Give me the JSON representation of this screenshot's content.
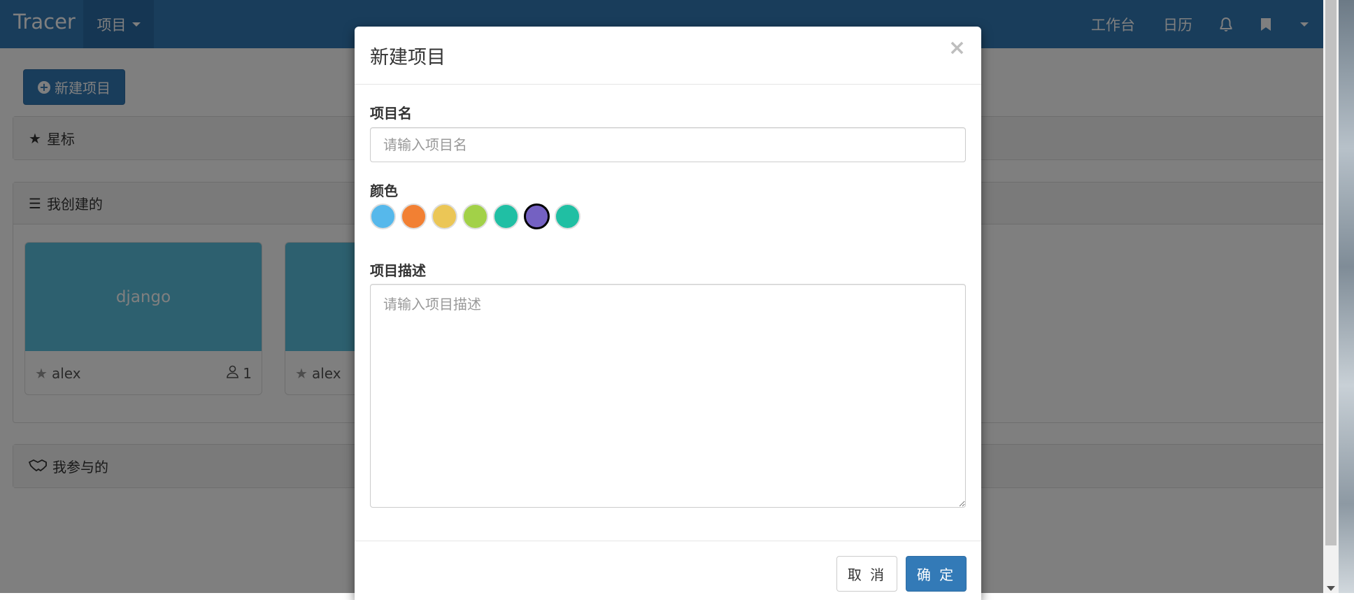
{
  "navbar": {
    "brand": "Tracer",
    "project_menu": "项目",
    "workbench": "工作台",
    "calendar": "日历"
  },
  "toolbar": {
    "new_project": "新建项目"
  },
  "panels": {
    "starred": "星标",
    "created": "我创建的",
    "joined": "我参与的"
  },
  "cards": [
    {
      "name": "django",
      "owner": "alex",
      "members": "1"
    },
    {
      "name": "",
      "owner": "alex",
      "members": ""
    }
  ],
  "modal": {
    "title": "新建项目",
    "close": "×",
    "name_label": "项目名",
    "name_placeholder": "请输入项目名",
    "color_label": "颜色",
    "colors": [
      "#56b8eb",
      "#f28033",
      "#ebc656",
      "#a2d148",
      "#20BFA4",
      "#7461c2",
      "#20bfa3"
    ],
    "selected_color_index": 5,
    "desc_label": "项目描述",
    "desc_placeholder": "请输入项目描述",
    "cancel": "取 消",
    "confirm": "确 定"
  }
}
